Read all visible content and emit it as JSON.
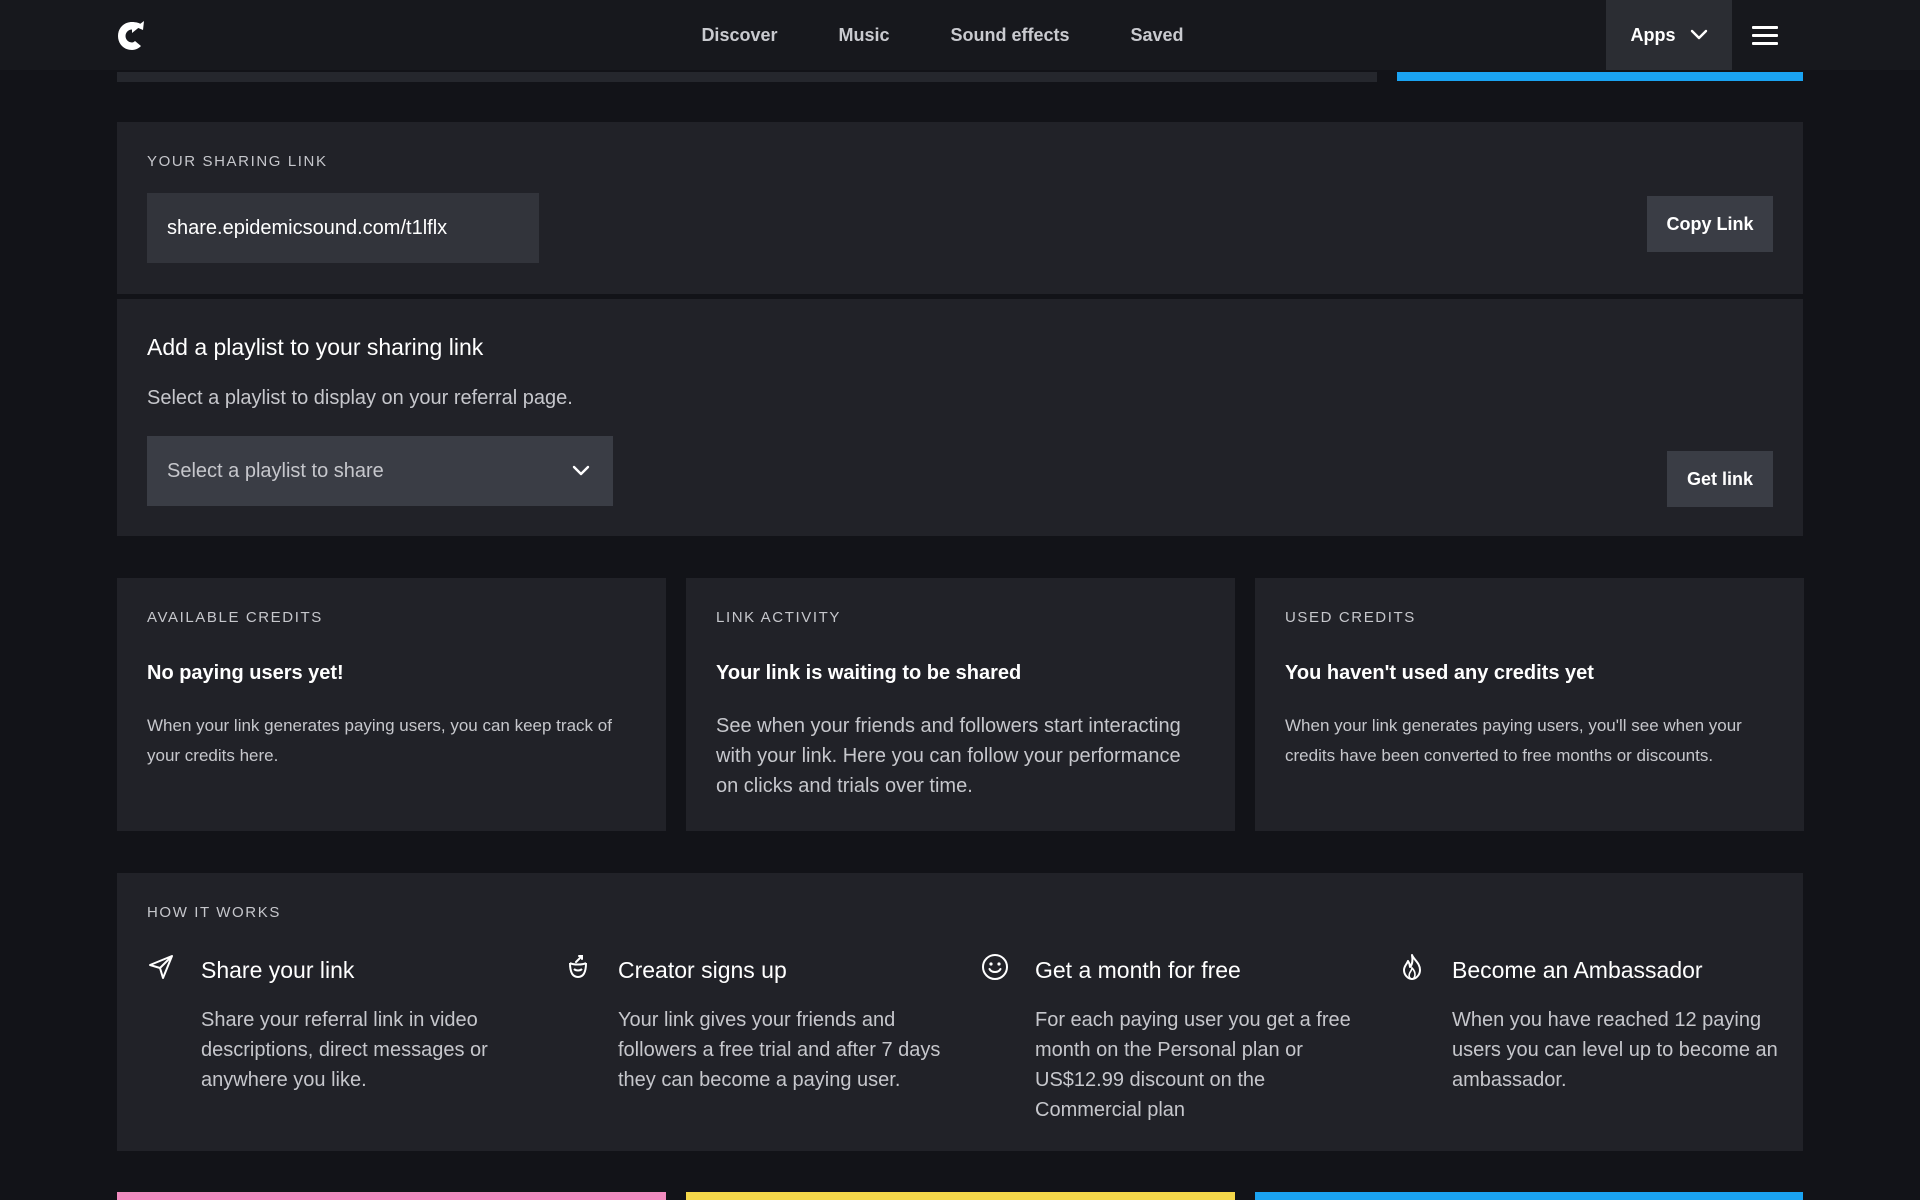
{
  "nav": {
    "links": [
      "Discover",
      "Music",
      "Sound effects",
      "Saved"
    ],
    "apps_label": "Apps",
    "logo_icon": "epidemic-logo-icon",
    "menu_icon": "hamburger-icon"
  },
  "colors": {
    "accent_blue": "#1aa3f2",
    "accent_pink": "#f28bbf",
    "accent_yellow": "#f5d84a",
    "panel_bg": "#212228",
    "page_bg": "#121318"
  },
  "sharing": {
    "label": "YOUR SHARING LINK",
    "link_value": "share.epidemicsound.com/t1lflx",
    "copy_button": "Copy Link"
  },
  "playlist": {
    "title": "Add a playlist to your sharing link",
    "description": "Select a playlist to display on your referral page.",
    "select_placeholder": "Select a playlist to share",
    "get_link_button": "Get link"
  },
  "cards": [
    {
      "label": "AVAILABLE CREDITS",
      "title": "No paying users yet!",
      "body": "When your link generates paying users, you can keep track of your credits here."
    },
    {
      "label": "LINK ACTIVITY",
      "title": "Your link is waiting to be shared",
      "body": "See when your friends and followers start interacting with your link. Here you can follow your performance on clicks and trials over time."
    },
    {
      "label": "USED CREDITS",
      "title": "You haven't used any credits yet",
      "body": "When your link generates paying users, you'll see when your credits have been converted to free months or discounts."
    }
  ],
  "how_it_works": {
    "label": "HOW IT WORKS",
    "steps": [
      {
        "icon": "paper-plane-icon",
        "title": "Share your link",
        "body": "Share your referral link in video descriptions, direct messages or anywhere you like."
      },
      {
        "icon": "signup-icon",
        "title": "Creator signs up",
        "body": "Your link gives your friends and followers a free trial and after 7 days they can become a paying user."
      },
      {
        "icon": "smiley-icon",
        "title": "Get a month for free",
        "body": "For each paying user you get a free month on the Personal plan or US$12.99 discount on the Commercial plan"
      },
      {
        "icon": "flame-icon",
        "title": "Become an Ambassador",
        "body": "When you have reached 12 paying users you can level up to become an ambassador."
      }
    ]
  }
}
